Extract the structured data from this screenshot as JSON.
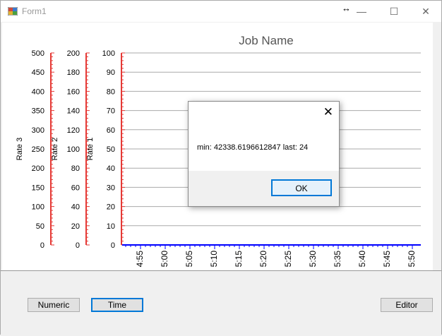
{
  "window": {
    "title": "Form1",
    "minimize_glyph": "—",
    "maximize_glyph": "☐",
    "close_glyph": "✕",
    "resize_cursor_glyph": "↔"
  },
  "colors": {
    "axis_red": "#e53935",
    "series_blue": "#0000ff",
    "grid": "#aaaaaa",
    "focus_blue": "#0078d7"
  },
  "chart_data": {
    "type": "line",
    "title": "Job Name",
    "axes": [
      {
        "name": "Rate 3",
        "ylim": [
          0,
          500
        ],
        "ticks": [
          0,
          50,
          100,
          150,
          200,
          250,
          300,
          350,
          400,
          450,
          500
        ]
      },
      {
        "name": "Rate 2",
        "ylim": [
          0,
          200
        ],
        "ticks": [
          0,
          20,
          40,
          60,
          80,
          100,
          120,
          140,
          160,
          180,
          200
        ]
      },
      {
        "name": "Rate 1",
        "ylim": [
          0,
          100
        ],
        "ticks": [
          0,
          10,
          20,
          30,
          40,
          50,
          60,
          70,
          80,
          90,
          100
        ]
      }
    ],
    "x_ticks": [
      "4:55",
      "5:00",
      "5:05",
      "5:10",
      "5:15",
      "5:20",
      "5:25",
      "5:30",
      "5:35",
      "5:40",
      "5:45",
      "5:50"
    ],
    "series": [
      {
        "values": [
          0,
          0,
          0,
          0,
          0,
          0,
          0,
          0,
          0,
          0,
          0,
          0
        ]
      }
    ],
    "grid": true
  },
  "dialog": {
    "message": "min: 42338.6196612847  last: 24",
    "ok_label": "OK",
    "close_glyph": "✕"
  },
  "buttons": {
    "numeric": "Numeric",
    "time": "Time",
    "editor": "Editor"
  }
}
